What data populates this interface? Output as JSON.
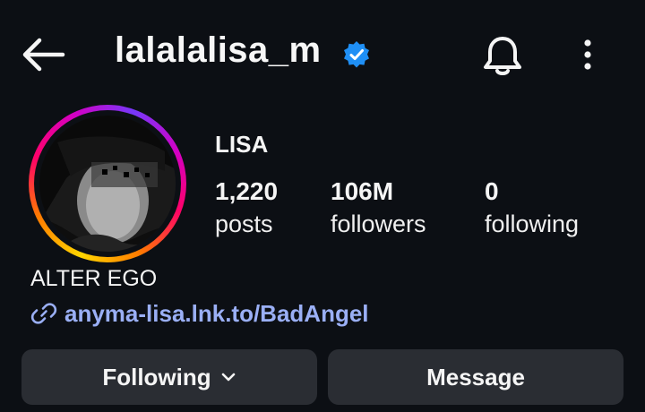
{
  "header": {
    "username": "lalalalisa_m",
    "verified": true,
    "icons": [
      "back-arrow-icon",
      "verified-badge-icon",
      "bell-icon",
      "more-vertical-icon"
    ]
  },
  "profile": {
    "display_name": "LISA",
    "bio": "ALTER EGO",
    "link": "anyma-lisa.lnk.to/BadAngel",
    "stats": {
      "posts_count": "1,220",
      "posts_label": "posts",
      "followers_count": "106M",
      "followers_label": "followers",
      "following_count": "0",
      "following_label": "following"
    }
  },
  "actions": {
    "following_label": "Following",
    "message_label": "Message"
  },
  "colors": {
    "background": "#0c0f14",
    "verified_blue": "#1f8ff5",
    "link": "#9aaff5",
    "button_bg": "#2a2d33",
    "story_ring": [
      "#ffd600",
      "#ff7a00",
      "#ff0169",
      "#d300c5",
      "#7638fa"
    ]
  }
}
